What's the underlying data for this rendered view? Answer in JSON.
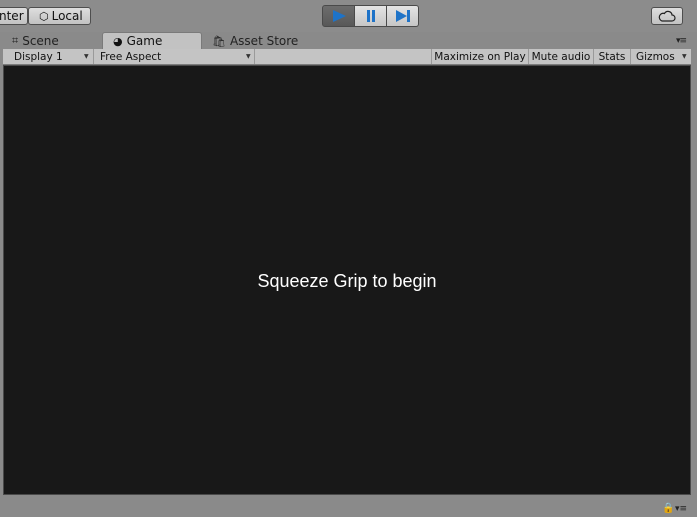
{
  "toolbar": {
    "pivot_label": "nter",
    "space_label": "Local"
  },
  "tabs": [
    {
      "label": "Scene",
      "icon": "grid-icon",
      "active": false
    },
    {
      "label": "Game",
      "icon": "pacman-icon",
      "active": true
    },
    {
      "label": "Asset Store",
      "icon": "shopping-bag-icon",
      "active": false
    }
  ],
  "game_toolbar": {
    "display": "Display 1",
    "aspect": "Free Aspect",
    "maximize": "Maximize on Play",
    "mute": "Mute audio",
    "stats": "Stats",
    "gizmos": "Gizmos"
  },
  "viewport": {
    "message": "Squeeze Grip to begin",
    "background": "#181818"
  },
  "colors": {
    "accent_blue": "#1e73c8"
  }
}
